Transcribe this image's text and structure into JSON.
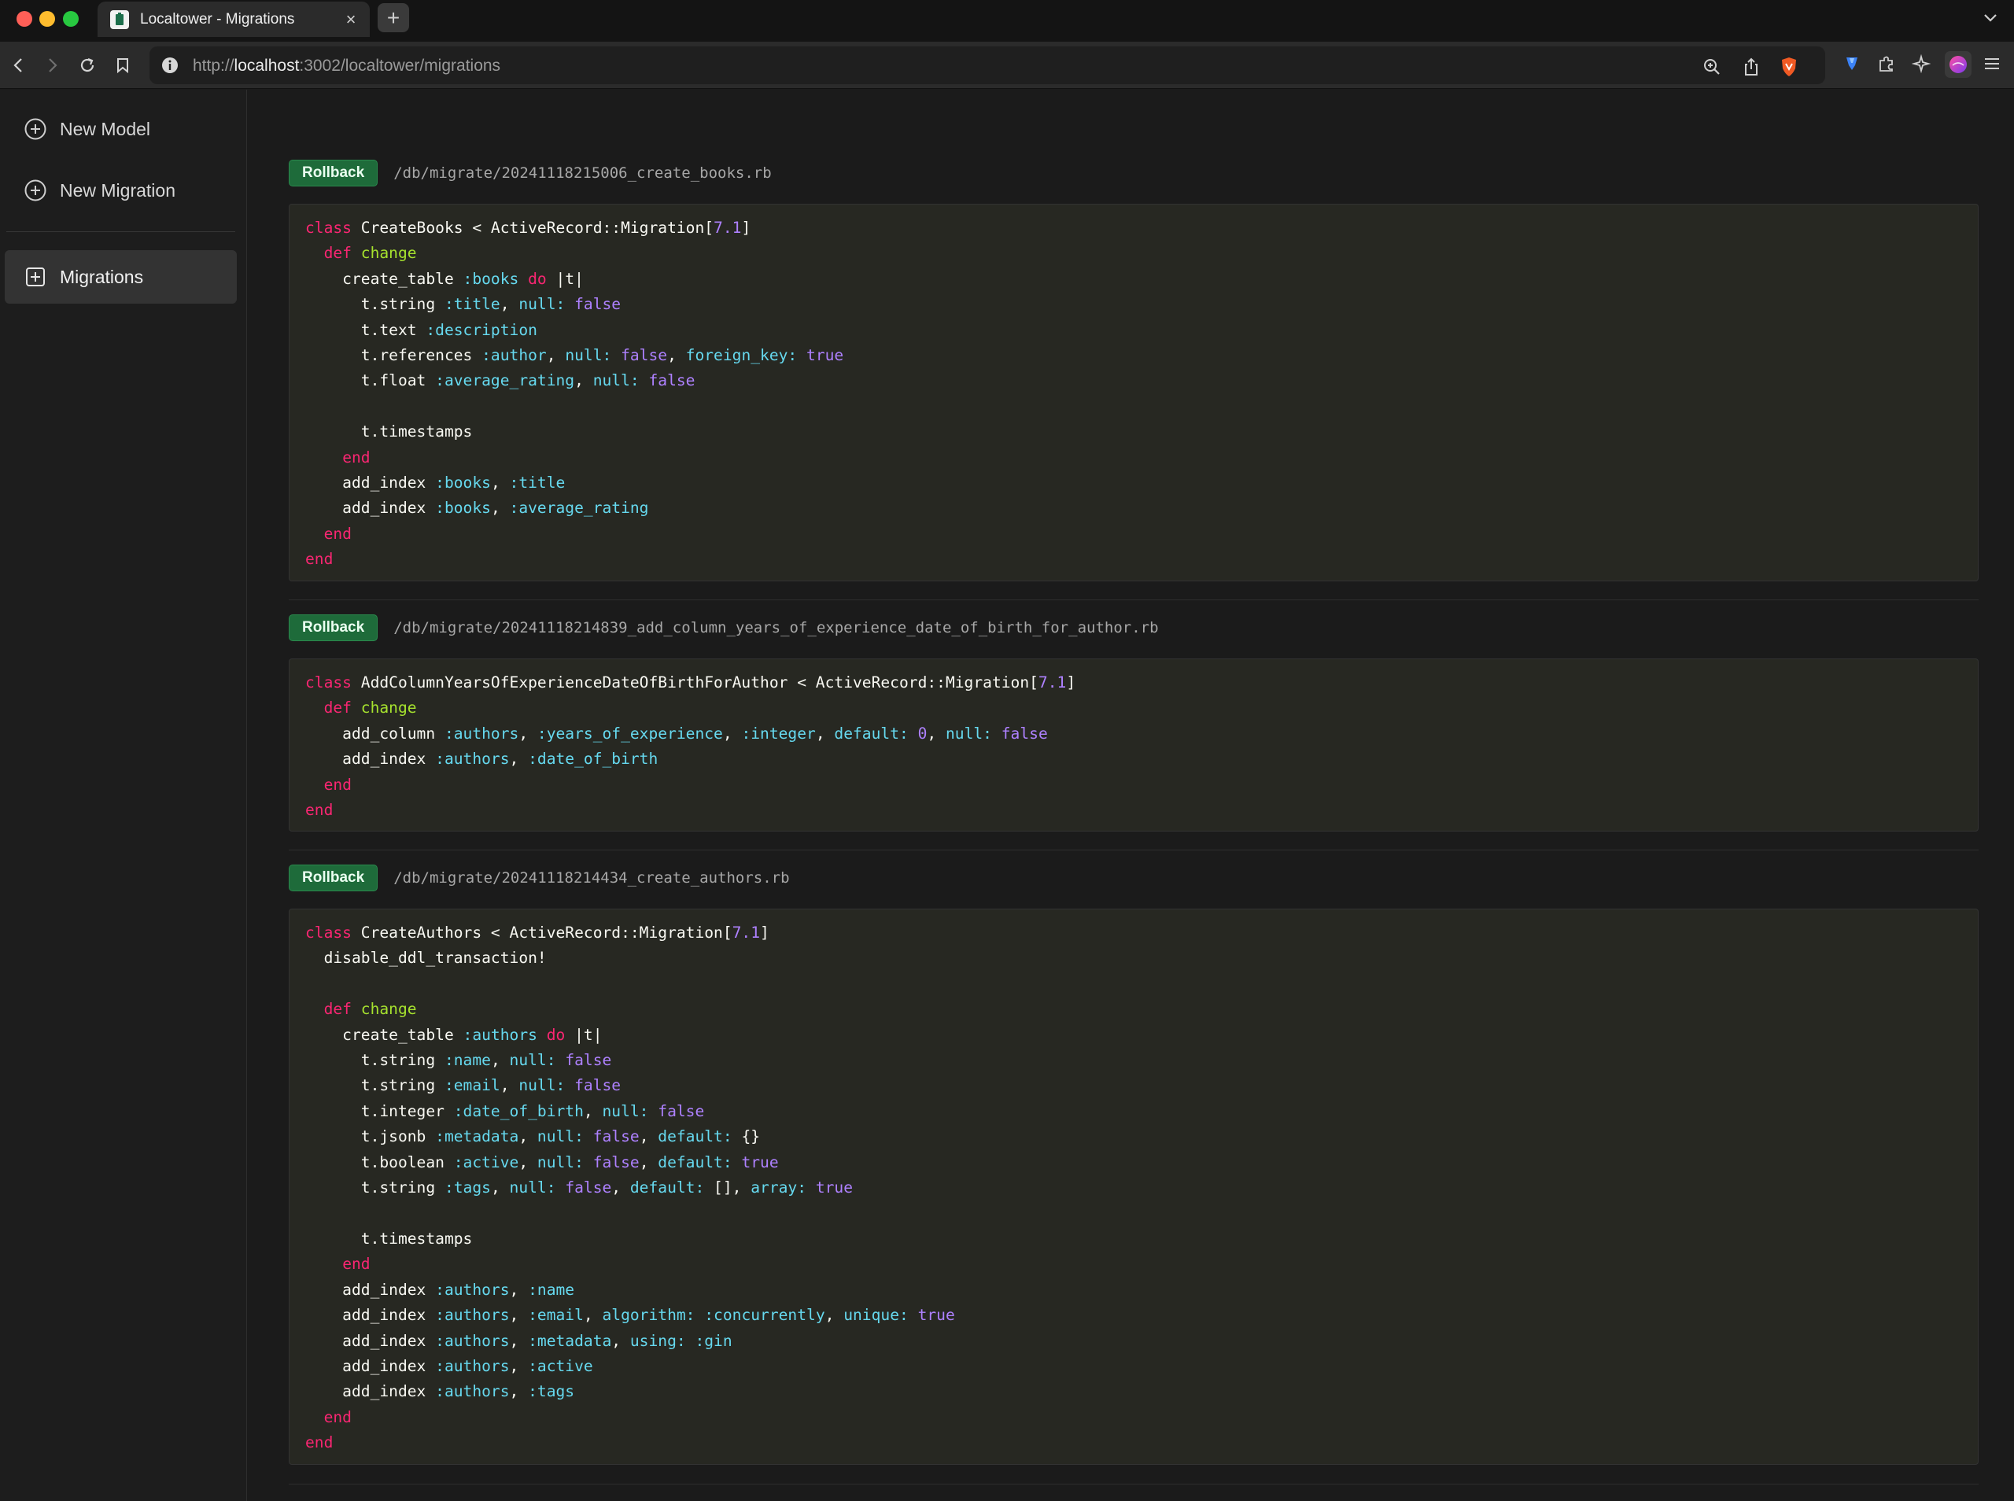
{
  "browser": {
    "tab_title": "Localtower - Migrations",
    "tab_close": "×",
    "new_tab": "+",
    "url_prefix": "http://",
    "url_host": "localhost",
    "url_rest": ":3002/localtower/migrations"
  },
  "sidebar": {
    "items": [
      {
        "label": "New Model",
        "icon": "plus-circle-icon"
      },
      {
        "label": "New Migration",
        "icon": "plus-circle-icon"
      },
      {
        "label": "Migrations",
        "icon": "plus-square-icon",
        "active": true
      }
    ]
  },
  "migrations": [
    {
      "button": "Rollback",
      "path": "/db/migrate/20241118215006_create_books.rb",
      "code": [
        [
          [
            "kw",
            "class"
          ],
          [
            "t",
            " CreateBooks < ActiveRecord::Migration["
          ],
          [
            "num",
            "7.1"
          ],
          [
            "t",
            "]"
          ]
        ],
        [
          [
            "t",
            "  "
          ],
          [
            "kw",
            "def"
          ],
          [
            "t",
            " "
          ],
          [
            "fn",
            "change"
          ]
        ],
        [
          [
            "t",
            "    create_table "
          ],
          [
            "sym",
            ":books"
          ],
          [
            "t",
            " "
          ],
          [
            "kw",
            "do"
          ],
          [
            "t",
            " |t|"
          ]
        ],
        [
          [
            "t",
            "      t.string "
          ],
          [
            "sym",
            ":title"
          ],
          [
            "t",
            ", "
          ],
          [
            "sym",
            "null:"
          ],
          [
            "t",
            " "
          ],
          [
            "bool",
            "false"
          ]
        ],
        [
          [
            "t",
            "      t.text "
          ],
          [
            "sym",
            ":description"
          ]
        ],
        [
          [
            "t",
            "      t.references "
          ],
          [
            "sym",
            ":author"
          ],
          [
            "t",
            ", "
          ],
          [
            "sym",
            "null:"
          ],
          [
            "t",
            " "
          ],
          [
            "bool",
            "false"
          ],
          [
            "t",
            ", "
          ],
          [
            "sym",
            "foreign_key:"
          ],
          [
            "t",
            " "
          ],
          [
            "bool",
            "true"
          ]
        ],
        [
          [
            "t",
            "      t.float "
          ],
          [
            "sym",
            ":average_rating"
          ],
          [
            "t",
            ", "
          ],
          [
            "sym",
            "null:"
          ],
          [
            "t",
            " "
          ],
          [
            "bool",
            "false"
          ]
        ],
        [
          [
            "t",
            ""
          ]
        ],
        [
          [
            "t",
            "      t.timestamps"
          ]
        ],
        [
          [
            "t",
            "    "
          ],
          [
            "kw",
            "end"
          ]
        ],
        [
          [
            "t",
            "    add_index "
          ],
          [
            "sym",
            ":books"
          ],
          [
            "t",
            ", "
          ],
          [
            "sym",
            ":title"
          ]
        ],
        [
          [
            "t",
            "    add_index "
          ],
          [
            "sym",
            ":books"
          ],
          [
            "t",
            ", "
          ],
          [
            "sym",
            ":average_rating"
          ]
        ],
        [
          [
            "t",
            "  "
          ],
          [
            "kw",
            "end"
          ]
        ],
        [
          [
            "kw",
            "end"
          ]
        ]
      ]
    },
    {
      "button": "Rollback",
      "path": "/db/migrate/20241118214839_add_column_years_of_experience_date_of_birth_for_author.rb",
      "code": [
        [
          [
            "kw",
            "class"
          ],
          [
            "t",
            " AddColumnYearsOfExperienceDateOfBirthForAuthor < ActiveRecord::Migration["
          ],
          [
            "num",
            "7.1"
          ],
          [
            "t",
            "]"
          ]
        ],
        [
          [
            "t",
            "  "
          ],
          [
            "kw",
            "def"
          ],
          [
            "t",
            " "
          ],
          [
            "fn",
            "change"
          ]
        ],
        [
          [
            "t",
            "    add_column "
          ],
          [
            "sym",
            ":authors"
          ],
          [
            "t",
            ", "
          ],
          [
            "sym",
            ":years_of_experience"
          ],
          [
            "t",
            ", "
          ],
          [
            "sym",
            ":integer"
          ],
          [
            "t",
            ", "
          ],
          [
            "sym",
            "default:"
          ],
          [
            "t",
            " "
          ],
          [
            "num",
            "0"
          ],
          [
            "t",
            ", "
          ],
          [
            "sym",
            "null:"
          ],
          [
            "t",
            " "
          ],
          [
            "bool",
            "false"
          ]
        ],
        [
          [
            "t",
            "    add_index "
          ],
          [
            "sym",
            ":authors"
          ],
          [
            "t",
            ", "
          ],
          [
            "sym",
            ":date_of_birth"
          ]
        ],
        [
          [
            "t",
            "  "
          ],
          [
            "kw",
            "end"
          ]
        ],
        [
          [
            "kw",
            "end"
          ]
        ]
      ]
    },
    {
      "button": "Rollback",
      "path": "/db/migrate/20241118214434_create_authors.rb",
      "code": [
        [
          [
            "kw",
            "class"
          ],
          [
            "t",
            " CreateAuthors < ActiveRecord::Migration["
          ],
          [
            "num",
            "7.1"
          ],
          [
            "t",
            "]"
          ]
        ],
        [
          [
            "t",
            "  disable_ddl_transaction!"
          ]
        ],
        [
          [
            "t",
            ""
          ]
        ],
        [
          [
            "t",
            "  "
          ],
          [
            "kw",
            "def"
          ],
          [
            "t",
            " "
          ],
          [
            "fn",
            "change"
          ]
        ],
        [
          [
            "t",
            "    create_table "
          ],
          [
            "sym",
            ":authors"
          ],
          [
            "t",
            " "
          ],
          [
            "kw",
            "do"
          ],
          [
            "t",
            " |t|"
          ]
        ],
        [
          [
            "t",
            "      t.string "
          ],
          [
            "sym",
            ":name"
          ],
          [
            "t",
            ", "
          ],
          [
            "sym",
            "null:"
          ],
          [
            "t",
            " "
          ],
          [
            "bool",
            "false"
          ]
        ],
        [
          [
            "t",
            "      t.string "
          ],
          [
            "sym",
            ":email"
          ],
          [
            "t",
            ", "
          ],
          [
            "sym",
            "null:"
          ],
          [
            "t",
            " "
          ],
          [
            "bool",
            "false"
          ]
        ],
        [
          [
            "t",
            "      t.integer "
          ],
          [
            "sym",
            ":date_of_birth"
          ],
          [
            "t",
            ", "
          ],
          [
            "sym",
            "null:"
          ],
          [
            "t",
            " "
          ],
          [
            "bool",
            "false"
          ]
        ],
        [
          [
            "t",
            "      t.jsonb "
          ],
          [
            "sym",
            ":metadata"
          ],
          [
            "t",
            ", "
          ],
          [
            "sym",
            "null:"
          ],
          [
            "t",
            " "
          ],
          [
            "bool",
            "false"
          ],
          [
            "t",
            ", "
          ],
          [
            "sym",
            "default:"
          ],
          [
            "t",
            " {}"
          ]
        ],
        [
          [
            "t",
            "      t.boolean "
          ],
          [
            "sym",
            ":active"
          ],
          [
            "t",
            ", "
          ],
          [
            "sym",
            "null:"
          ],
          [
            "t",
            " "
          ],
          [
            "bool",
            "false"
          ],
          [
            "t",
            ", "
          ],
          [
            "sym",
            "default:"
          ],
          [
            "t",
            " "
          ],
          [
            "bool",
            "true"
          ]
        ],
        [
          [
            "t",
            "      t.string "
          ],
          [
            "sym",
            ":tags"
          ],
          [
            "t",
            ", "
          ],
          [
            "sym",
            "null:"
          ],
          [
            "t",
            " "
          ],
          [
            "bool",
            "false"
          ],
          [
            "t",
            ", "
          ],
          [
            "sym",
            "default:"
          ],
          [
            "t",
            " [], "
          ],
          [
            "sym",
            "array:"
          ],
          [
            "t",
            " "
          ],
          [
            "bool",
            "true"
          ]
        ],
        [
          [
            "t",
            ""
          ]
        ],
        [
          [
            "t",
            "      t.timestamps"
          ]
        ],
        [
          [
            "t",
            "    "
          ],
          [
            "kw",
            "end"
          ]
        ],
        [
          [
            "t",
            "    add_index "
          ],
          [
            "sym",
            ":authors"
          ],
          [
            "t",
            ", "
          ],
          [
            "sym",
            ":name"
          ]
        ],
        [
          [
            "t",
            "    add_index "
          ],
          [
            "sym",
            ":authors"
          ],
          [
            "t",
            ", "
          ],
          [
            "sym",
            ":email"
          ],
          [
            "t",
            ", "
          ],
          [
            "sym",
            "algorithm:"
          ],
          [
            "t",
            " "
          ],
          [
            "sym",
            ":concurrently"
          ],
          [
            "t",
            ", "
          ],
          [
            "sym",
            "unique:"
          ],
          [
            "t",
            " "
          ],
          [
            "bool",
            "true"
          ]
        ],
        [
          [
            "t",
            "    add_index "
          ],
          [
            "sym",
            ":authors"
          ],
          [
            "t",
            ", "
          ],
          [
            "sym",
            ":metadata"
          ],
          [
            "t",
            ", "
          ],
          [
            "sym",
            "using:"
          ],
          [
            "t",
            " "
          ],
          [
            "sym",
            ":gin"
          ]
        ],
        [
          [
            "t",
            "    add_index "
          ],
          [
            "sym",
            ":authors"
          ],
          [
            "t",
            ", "
          ],
          [
            "sym",
            ":active"
          ]
        ],
        [
          [
            "t",
            "    add_index "
          ],
          [
            "sym",
            ":authors"
          ],
          [
            "t",
            ", "
          ],
          [
            "sym",
            ":tags"
          ]
        ],
        [
          [
            "t",
            "  "
          ],
          [
            "kw",
            "end"
          ]
        ],
        [
          [
            "kw",
            "end"
          ]
        ]
      ]
    }
  ],
  "colors": {
    "rollback_bg": "#1e6b3a",
    "keyword": "#f92672",
    "function": "#a6e22e",
    "symbol": "#66d9ef",
    "number": "#ae81ff",
    "code_bg": "#272822"
  }
}
